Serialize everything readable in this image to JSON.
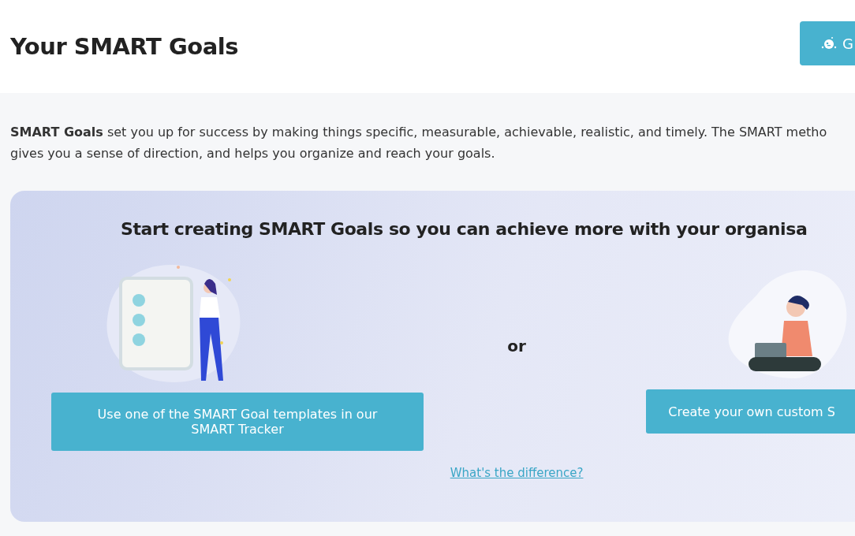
{
  "page_title": "Your SMART Goals",
  "header_button": {
    "label": "G"
  },
  "intro": "**SMART Goals** set you up for success by making things specific, measurable, achievable, realistic, and timely. The SMART metho\ngives you a sense of direction, and helps you organize and reach your goals.",
  "card": {
    "heading": "Start creating SMART Goals so you can achieve more with your organisa",
    "left_button": "Use one of the SMART Goal templates in our SMART Tracker",
    "separator": "or",
    "right_button": "Create your own custom S",
    "link": "What's the difference?"
  }
}
